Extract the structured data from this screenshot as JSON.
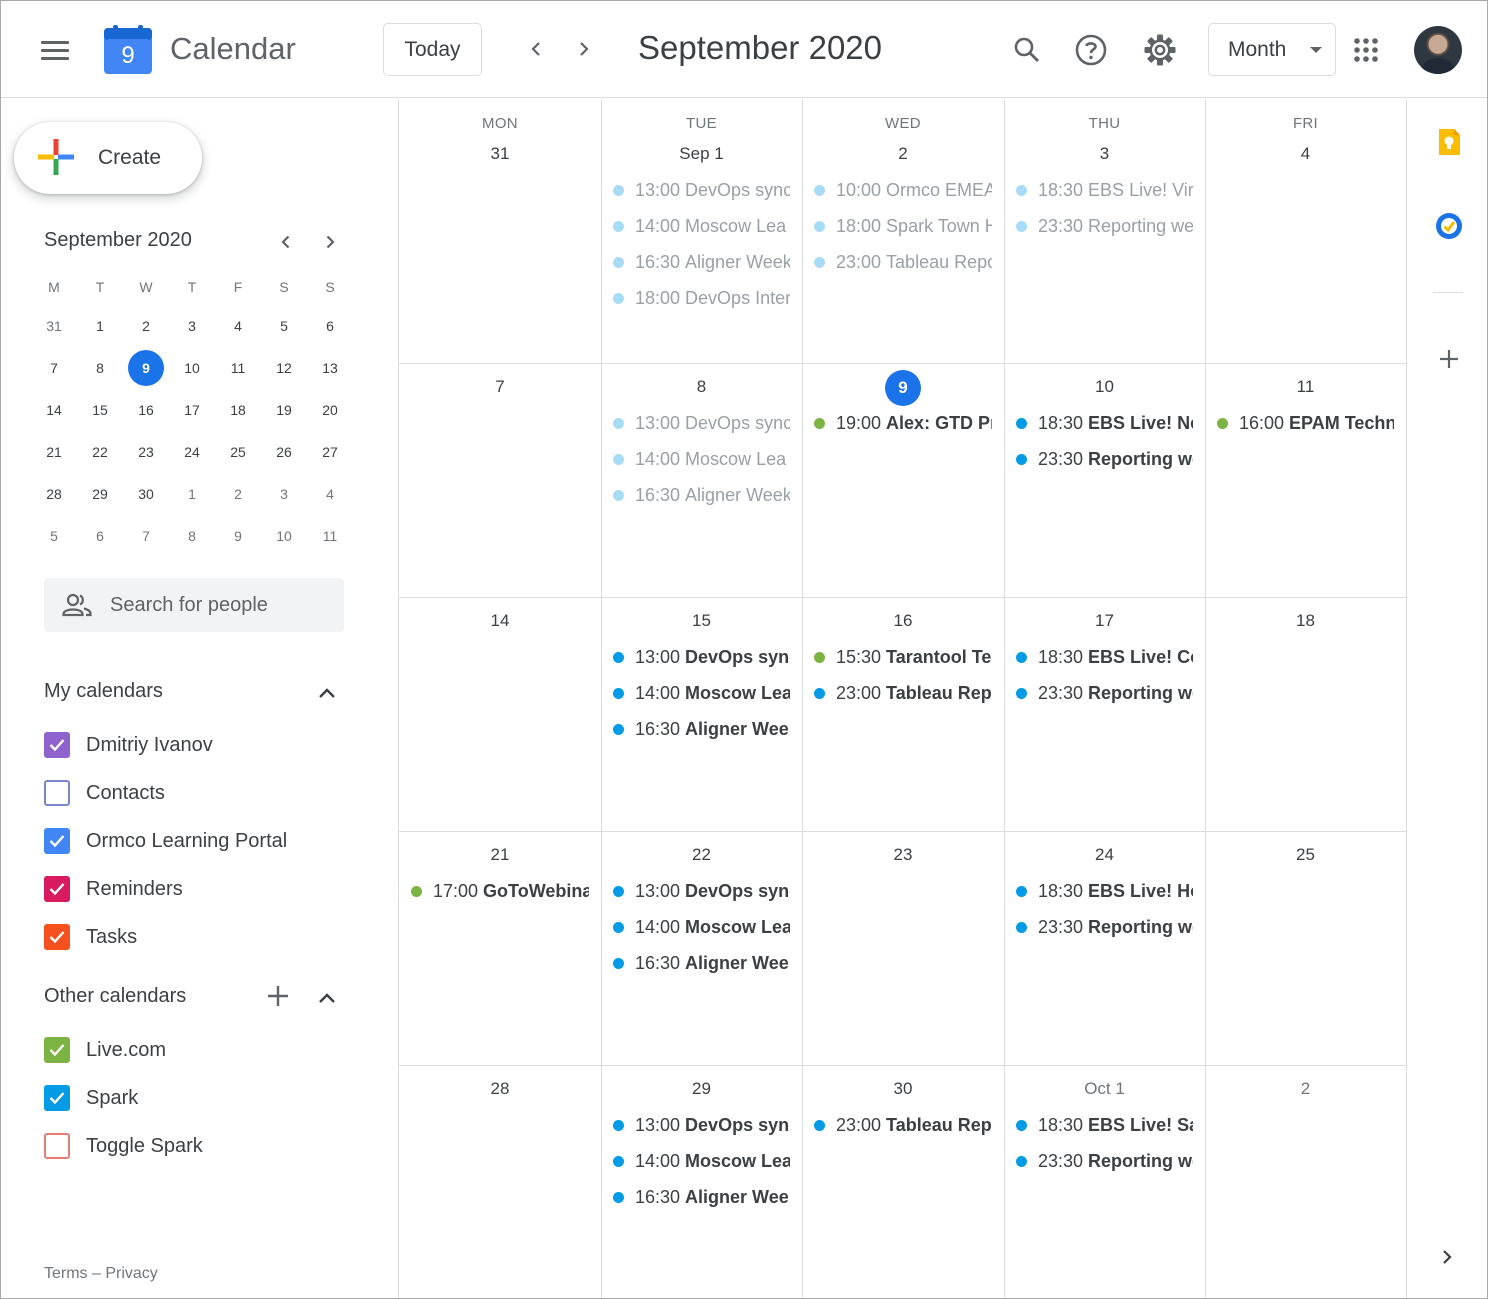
{
  "header": {
    "app_title": "Calendar",
    "logo_day": "9",
    "today_label": "Today",
    "title": "September 2020",
    "view_label": "Month"
  },
  "sidebar": {
    "create_label": "Create",
    "mini": {
      "title": "September 2020",
      "weekdays": [
        "M",
        "T",
        "W",
        "T",
        "F",
        "S",
        "S"
      ],
      "rows": [
        [
          "31",
          "1",
          "2",
          "3",
          "4",
          "5",
          "6"
        ],
        [
          "7",
          "8",
          "9",
          "10",
          "11",
          "12",
          "13"
        ],
        [
          "14",
          "15",
          "16",
          "17",
          "18",
          "19",
          "20"
        ],
        [
          "21",
          "22",
          "23",
          "24",
          "25",
          "26",
          "27"
        ],
        [
          "28",
          "29",
          "30",
          "1",
          "2",
          "3",
          "4"
        ],
        [
          "5",
          "6",
          "7",
          "8",
          "9",
          "10",
          "11"
        ]
      ],
      "selected_day": "9"
    },
    "search_people_placeholder": "Search for people",
    "my_calendars_title": "My calendars",
    "my_calendars": [
      {
        "label": "Dmitriy Ivanov",
        "color": "#8e63ce",
        "checked": true
      },
      {
        "label": "Contacts",
        "color": "#7986cb",
        "checked": false
      },
      {
        "label": "Ormco Learning Portal",
        "color": "#4285f4",
        "checked": true
      },
      {
        "label": "Reminders",
        "color": "#d81b60",
        "checked": true
      },
      {
        "label": "Tasks",
        "color": "#f4511e",
        "checked": true
      }
    ],
    "other_calendars_title": "Other calendars",
    "other_calendars": [
      {
        "label": "Live.com",
        "color": "#7cb342",
        "checked": true
      },
      {
        "label": "Spark",
        "color": "#039be5",
        "checked": true
      },
      {
        "label": "Toggle Spark",
        "color": "#e67c73",
        "checked": false
      }
    ],
    "footer": "Terms – Privacy"
  },
  "colors": {
    "blue": "#039be5",
    "green": "#7cb342",
    "past_blue": "#a8dcf5",
    "accent": "#1a73e8"
  },
  "grid": {
    "weekdays": [
      "MON",
      "TUE",
      "WED",
      "THU",
      "FRI"
    ],
    "weeks": [
      [
        {
          "label": "31",
          "events": []
        },
        {
          "label": "Sep 1",
          "events": [
            {
              "time": "13:00",
              "name": "DevOps sync",
              "color": "blue",
              "past": true
            },
            {
              "time": "14:00",
              "name": "Moscow Lea",
              "color": "blue",
              "past": true
            },
            {
              "time": "16:30",
              "name": "Aligner Week",
              "color": "blue",
              "past": true
            },
            {
              "time": "18:00",
              "name": "DevOps Inter",
              "color": "blue",
              "past": true
            }
          ]
        },
        {
          "label": "2",
          "events": [
            {
              "time": "10:00",
              "name": "Ormco EMEA",
              "color": "blue",
              "past": true
            },
            {
              "time": "18:00",
              "name": "Spark Town H",
              "color": "blue",
              "past": true
            },
            {
              "time": "23:00",
              "name": "Tableau Repo",
              "color": "blue",
              "past": true
            }
          ]
        },
        {
          "label": "3",
          "events": [
            {
              "time": "18:30",
              "name": "EBS Live! Vir",
              "color": "blue",
              "past": true
            },
            {
              "time": "23:30",
              "name": "Reporting we",
              "color": "blue",
              "past": true
            }
          ]
        },
        {
          "label": "4",
          "events": []
        }
      ],
      [
        {
          "label": "7",
          "events": []
        },
        {
          "label": "8",
          "events": [
            {
              "time": "13:00",
              "name": "DevOps sync",
              "color": "blue",
              "past": true
            },
            {
              "time": "14:00",
              "name": "Moscow Lea",
              "color": "blue",
              "past": true
            },
            {
              "time": "16:30",
              "name": "Aligner Week",
              "color": "blue",
              "past": true
            }
          ]
        },
        {
          "label": "9",
          "today": true,
          "events": [
            {
              "time": "19:00",
              "name": "Alex: GTD Pr",
              "color": "green",
              "past": false
            }
          ]
        },
        {
          "label": "10",
          "events": [
            {
              "time": "18:30",
              "name": "EBS Live! Ne",
              "color": "blue",
              "past": false
            },
            {
              "time": "23:30",
              "name": "Reporting we",
              "color": "blue",
              "past": false
            }
          ]
        },
        {
          "label": "11",
          "events": [
            {
              "time": "16:00",
              "name": "EPAM Techn",
              "color": "green",
              "past": false
            }
          ]
        }
      ],
      [
        {
          "label": "14",
          "events": []
        },
        {
          "label": "15",
          "events": [
            {
              "time": "13:00",
              "name": "DevOps sync",
              "color": "blue",
              "past": false
            },
            {
              "time": "14:00",
              "name": "Moscow Lea",
              "color": "blue",
              "past": false
            },
            {
              "time": "16:30",
              "name": "Aligner Week",
              "color": "blue",
              "past": false
            }
          ]
        },
        {
          "label": "16",
          "events": [
            {
              "time": "15:30",
              "name": "Tarantool Tea",
              "color": "green",
              "past": false
            },
            {
              "time": "23:00",
              "name": "Tableau Repo",
              "color": "blue",
              "past": false
            }
          ]
        },
        {
          "label": "17",
          "events": [
            {
              "time": "18:30",
              "name": "EBS Live! Co",
              "color": "blue",
              "past": false
            },
            {
              "time": "23:30",
              "name": "Reporting we",
              "color": "blue",
              "past": false
            }
          ]
        },
        {
          "label": "18",
          "events": []
        }
      ],
      [
        {
          "label": "21",
          "events": [
            {
              "time": "17:00",
              "name": "GoToWebina",
              "color": "green",
              "past": false
            }
          ]
        },
        {
          "label": "22",
          "events": [
            {
              "time": "13:00",
              "name": "DevOps sync",
              "color": "blue",
              "past": false
            },
            {
              "time": "14:00",
              "name": "Moscow Lea",
              "color": "blue",
              "past": false
            },
            {
              "time": "16:30",
              "name": "Aligner Week",
              "color": "blue",
              "past": false
            }
          ]
        },
        {
          "label": "23",
          "events": []
        },
        {
          "label": "24",
          "events": [
            {
              "time": "18:30",
              "name": "EBS Live! Ho",
              "color": "blue",
              "past": false
            },
            {
              "time": "23:30",
              "name": "Reporting we",
              "color": "blue",
              "past": false
            }
          ]
        },
        {
          "label": "25",
          "events": []
        }
      ],
      [
        {
          "label": "28",
          "events": []
        },
        {
          "label": "29",
          "events": [
            {
              "time": "13:00",
              "name": "DevOps sync",
              "color": "blue",
              "past": false
            },
            {
              "time": "14:00",
              "name": "Moscow Lea",
              "color": "blue",
              "past": false
            },
            {
              "time": "16:30",
              "name": "Aligner Week",
              "color": "blue",
              "past": false
            }
          ]
        },
        {
          "label": "30",
          "events": [
            {
              "time": "23:00",
              "name": "Tableau Repo",
              "color": "blue",
              "past": false
            }
          ]
        },
        {
          "label": "Oct 1",
          "muted": true,
          "events": [
            {
              "time": "18:30",
              "name": "EBS Live! Sal",
              "color": "blue",
              "past": false
            },
            {
              "time": "23:30",
              "name": "Reporting we",
              "color": "blue",
              "past": false
            }
          ]
        },
        {
          "label": "2",
          "muted": true,
          "events": []
        }
      ]
    ]
  }
}
